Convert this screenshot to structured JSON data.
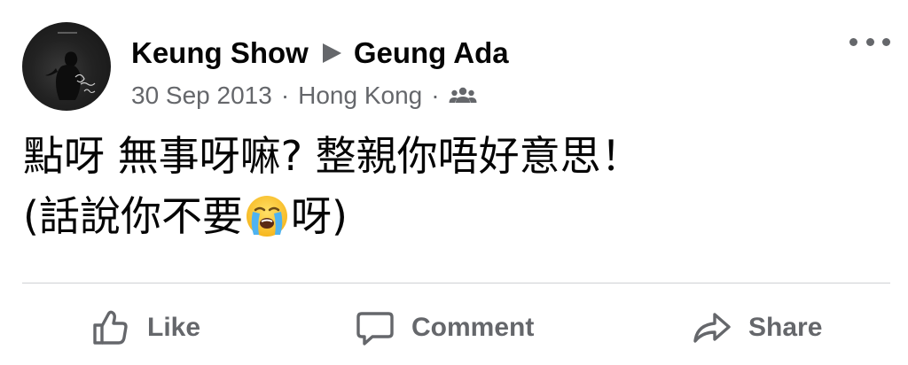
{
  "post": {
    "author": "Keung Show",
    "recipient": "Geung Ada",
    "date": "30 Sep 2013",
    "separator": "·",
    "location": "Hong Kong",
    "audience_icon": "friends-icon",
    "more_icon": "more-horizontal-icon",
    "body_line1": "點呀 無事呀嘛? 整親你唔好意思！",
    "body_line2_before": "(話說你不要",
    "body_emoji": "loudly-crying-face-emoji",
    "body_line2_after": "呀)"
  },
  "actions": {
    "like_label": "Like",
    "comment_label": "Comment",
    "share_label": "Share"
  },
  "colors": {
    "text_primary": "#050505",
    "text_secondary": "#65676b",
    "divider": "#ced0d4"
  }
}
